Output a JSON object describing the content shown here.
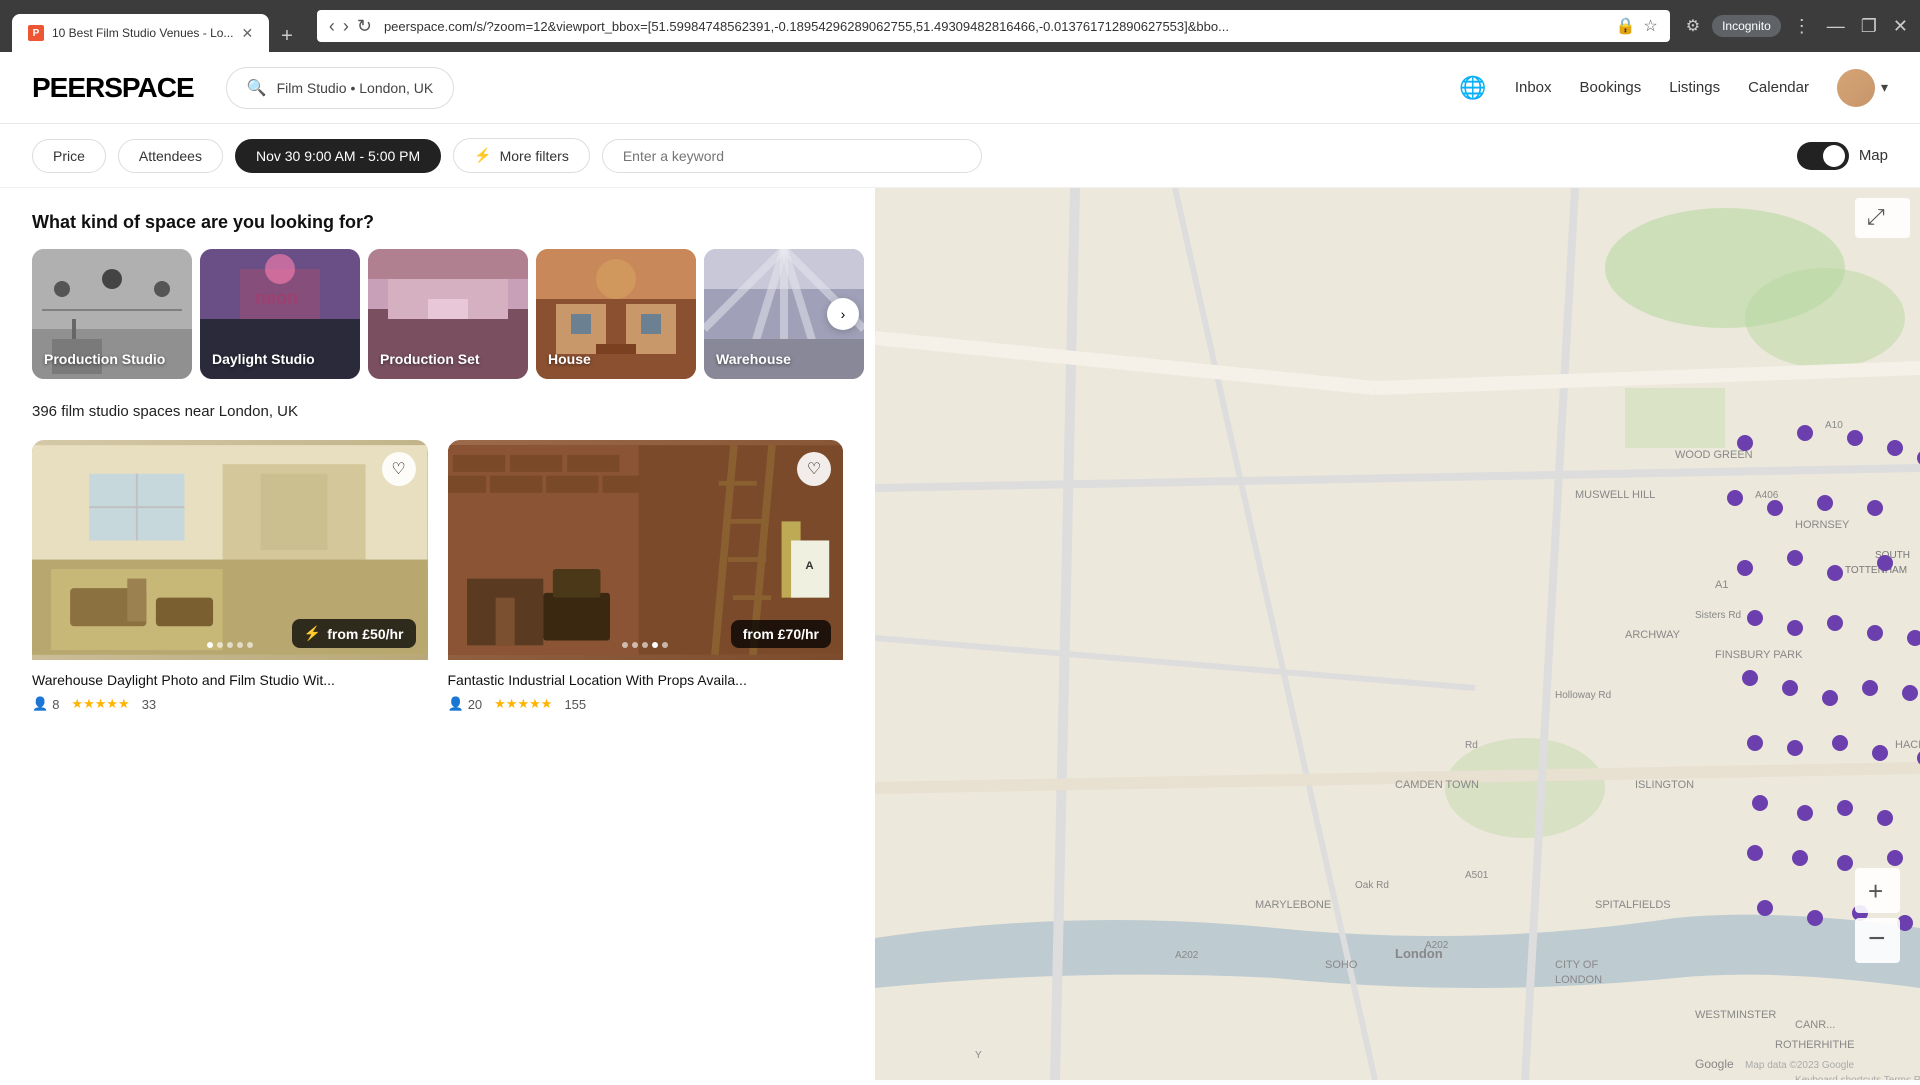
{
  "browser": {
    "tab_title": "10 Best Film Studio Venues - Lo...",
    "url": "peerspace.com/s/?zoom=12&viewport_bbox=[51.59984748562391,-0.18954296289062755,51.49309482816466,-0.013761712890627553]&bbo...",
    "new_tab_label": "+",
    "incognito_label": "Incognito"
  },
  "navbar": {
    "logo": "PEERSPACE",
    "search_query": "Film Studio • London, UK",
    "globe_icon": "🌐",
    "inbox": "Inbox",
    "bookings": "Bookings",
    "listings": "Listings",
    "calendar": "Calendar",
    "dropdown_icon": "▾"
  },
  "filters": {
    "price_label": "Price",
    "attendees_label": "Attendees",
    "datetime_label": "Nov 30 9:00 AM - 5:00 PM",
    "more_filters_label": "More filters",
    "keyword_placeholder": "Enter a keyword",
    "map_label": "Map",
    "filter_icon": "⚡"
  },
  "space_types": {
    "heading": "What kind of space are you looking for?",
    "cards": [
      {
        "id": "production-studio",
        "label": "Production Studio",
        "color_class": "card-production-studio"
      },
      {
        "id": "daylight-studio",
        "label": "Daylight Studio",
        "color_class": "card-daylight-studio"
      },
      {
        "id": "production-set",
        "label": "Production Set",
        "color_class": "card-production-set"
      },
      {
        "id": "house",
        "label": "House",
        "color_class": "card-house"
      },
      {
        "id": "warehouse",
        "label": "Warehouse",
        "color_class": "card-warehouse"
      }
    ]
  },
  "results": {
    "count_text": "396 film studio spaces near London, UK"
  },
  "listings": [
    {
      "id": "listing-1",
      "title": "Warehouse Daylight Photo and Film Studio Wit...",
      "price": "from £50/hr",
      "has_lightning": true,
      "attendees": 8,
      "stars": 5,
      "review_count": 33,
      "color_class": "listing1-bg",
      "dots": [
        true,
        false,
        false,
        false,
        false
      ]
    },
    {
      "id": "listing-2",
      "title": "Fantastic Industrial Location With Props Availa...",
      "price": "from £70/hr",
      "has_lightning": false,
      "attendees": 20,
      "stars": 5,
      "review_count": 155,
      "color_class": "listing2-bg",
      "dots": [
        false,
        false,
        false,
        true,
        false
      ]
    }
  ],
  "icons": {
    "heart": "♡",
    "heart_filled": "♥",
    "search": "🔍",
    "person": "👤",
    "star": "★",
    "lightning": "⚡",
    "chevron_right": "›",
    "zoom_in": "+",
    "zoom_out": "−",
    "fullscreen": "⤢"
  }
}
